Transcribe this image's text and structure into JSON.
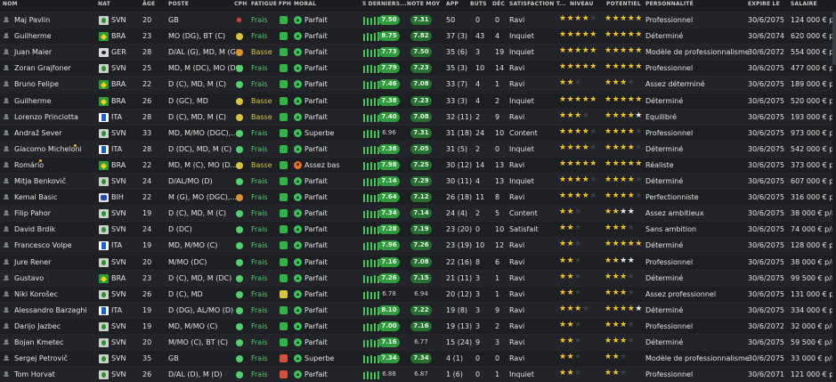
{
  "headers": {
    "nom": "NOM",
    "nat": "NAT",
    "age": "ÂGE",
    "poste": "POSTE",
    "cph": "CPH",
    "fatigue": "FATIGUE",
    "fph": "FPH",
    "moral": "MORAL",
    "derniers": "5 DERNIERS...",
    "note": "NOTE MOY",
    "app": "APP",
    "buts": "BUTS",
    "dec": "DÉC",
    "satisfaction": "SATISFACTION T...",
    "niveau": "NIVEAU",
    "potentiel": "POTENTIEL",
    "personnalite": "PERSONNALITÉ",
    "expire": "EXPIRE LE",
    "salaire": "SALAIRE"
  },
  "rows": [
    {
      "name": "Maj Pavlin",
      "nat": "SVN",
      "age": "20",
      "pos": "GB",
      "cph": "r",
      "fatigue": "Frais",
      "fat_color": "green",
      "fph": "g",
      "moral": "Parfait",
      "moral_c": "g",
      "last5": [
        9,
        8,
        8,
        9,
        9
      ],
      "form_rating": "7.50",
      "note": "7.31",
      "app": "50",
      "buts": "0",
      "dec": "0",
      "satisfaction": "Ravi",
      "niveau": "★★★★",
      "niveau_e": "★",
      "potentiel": "★★★★★",
      "pot_w": "",
      "pot_e": "",
      "personnalite": "Professionnel",
      "expire": "30/6/2075",
      "salaire": "124 000 € p/m"
    },
    {
      "name": "Guilherme",
      "nat": "BRA",
      "age": "23",
      "pos": "MO (DG), BT (C)",
      "cph": "y",
      "fatigue": "Frais",
      "fat_color": "green",
      "fph": "g",
      "moral": "Parfait",
      "moral_c": "g",
      "last5": [
        8,
        9,
        8,
        9,
        10
      ],
      "form_rating": "8.75",
      "note": "7.82",
      "app": "37 (3)",
      "buts": "43",
      "dec": "4",
      "satisfaction": "Inquiet",
      "niveau": "★★★★★",
      "niveau_e": "",
      "potentiel": "★★★★★",
      "pot_w": "",
      "pot_e": "",
      "personnalite": "Déterminé",
      "expire": "30/6/2074",
      "salaire": "620 000 € p/m"
    },
    {
      "name": "Juan Maier",
      "nat": "GER",
      "age": "28",
      "pos": "D/AL (G), MD, M (G)",
      "cph": "o",
      "fatigue": "Basse",
      "fat_color": "yellow",
      "fph": "g",
      "moral": "Parfait",
      "moral_c": "g",
      "last5": [
        8,
        9,
        8,
        9,
        9
      ],
      "form_rating": "7.73",
      "note": "7.50",
      "app": "35 (6)",
      "buts": "3",
      "dec": "19",
      "satisfaction": "Inquiet",
      "niveau": "★★★★★",
      "niveau_e": "",
      "potentiel": "★★★★★",
      "pot_w": "",
      "pot_e": "",
      "personnalite": "Modèle de professionnalisme",
      "expire": "30/6/2072",
      "salaire": "554 000 € p/m"
    },
    {
      "name": "Zoran Grajfoner",
      "nat": "SVN",
      "age": "25",
      "pos": "MD, M (DC), MO (DC)",
      "cph": "h",
      "fatigue": "Frais",
      "fat_color": "green",
      "fph": "g",
      "moral": "Parfait",
      "moral_c": "g",
      "last5": [
        8,
        9,
        9,
        8,
        9
      ],
      "form_rating": "7.79",
      "note": "7.23",
      "app": "35 (3)",
      "buts": "10",
      "dec": "14",
      "satisfaction": "Ravi",
      "niveau": "★★★★★",
      "niveau_e": "",
      "potentiel": "★★★★★",
      "pot_w": "",
      "pot_e": "",
      "personnalite": "Professionnel",
      "expire": "30/6/2075",
      "salaire": "477 000 € p/m"
    },
    {
      "name": "Bruno Felipe",
      "nat": "BRA",
      "age": "22",
      "pos": "D (C), MD, M (C)",
      "cph": "h",
      "fatigue": "Frais",
      "fat_color": "green",
      "fph": "g",
      "moral": "Parfait",
      "moral_c": "g",
      "last5": [
        9,
        8,
        9,
        8,
        9
      ],
      "form_rating": "7.46",
      "note": "7.08",
      "app": "33 (7)",
      "buts": "4",
      "dec": "1",
      "satisfaction": "Ravi",
      "niveau": "★★",
      "niveau_e": "★",
      "potentiel": "★★★",
      "pot_w": "",
      "pot_e": "★",
      "personnalite": "Assez déterminé",
      "expire": "30/6/2075",
      "salaire": "189 000 € p/m"
    },
    {
      "name": "Guilherme",
      "nat": "BRA",
      "age": "26",
      "pos": "D (GC), MD",
      "cph": "y",
      "fatigue": "Basse",
      "fat_color": "yellow",
      "fph": "g",
      "moral": "Parfait",
      "moral_c": "g",
      "last5": [
        8,
        9,
        8,
        9,
        8
      ],
      "form_rating": "7.38",
      "note": "7.23",
      "app": "33 (3)",
      "buts": "4",
      "dec": "2",
      "satisfaction": "Inquiet",
      "niveau": "★★★★★",
      "niveau_e": "",
      "potentiel": "★★★★★",
      "pot_w": "",
      "pot_e": "",
      "personnalite": "Déterminé",
      "expire": "30/6/2075",
      "salaire": "520 000 € p/m"
    },
    {
      "name": "Lorenzo Princiotta",
      "nat": "ITA",
      "age": "28",
      "pos": "D (C), MD, M (C)",
      "cph": "y",
      "fatigue": "Basse",
      "fat_color": "yellow",
      "fph": "g",
      "moral": "Parfait",
      "moral_c": "g",
      "last5": [
        9,
        8,
        8,
        9,
        8
      ],
      "form_rating": "7.40",
      "note": "7.08",
      "app": "32 (11)",
      "buts": "2",
      "dec": "9",
      "satisfaction": "Ravi",
      "niveau": "★★★",
      "niveau_e": "★",
      "potentiel": "★★★★",
      "pot_w": "★",
      "pot_e": "",
      "personnalite": "Equilibré",
      "expire": "30/6/2075",
      "salaire": "193 000 € p/m"
    },
    {
      "name": "Andraž Sever",
      "nat": "SVN",
      "age": "33",
      "pos": "MD, M/MO (DGC),...",
      "cph": "h",
      "fatigue": "Frais",
      "fat_color": "green",
      "fph": "g",
      "moral": "Superbe",
      "moral_c": "g",
      "last5": [
        8,
        9,
        9,
        8,
        9
      ],
      "form_rating": "6.96",
      "note": "7.31",
      "app": "31 (18)",
      "buts": "24",
      "dec": "10",
      "satisfaction": "Content",
      "niveau": "★★★★",
      "niveau_e": "★",
      "potentiel": "★★★★",
      "pot_w": "",
      "pot_e": "★",
      "personnalite": "Professionnel",
      "expire": "30/6/2075",
      "salaire": "973 000 € p/m"
    },
    {
      "name": "Giacomo Micheloni",
      "nat": "ITA",
      "age": "28",
      "pos": "D (DC), MD, M (C)",
      "cph": "h",
      "fatigue": "Frais",
      "fat_color": "green",
      "fph": "g",
      "moral": "Parfait",
      "moral_c": "g",
      "last5": [
        8,
        8,
        9,
        9,
        8
      ],
      "form_rating": "7.38",
      "note": "7.05",
      "app": "31 (5)",
      "buts": "2",
      "dec": "0",
      "satisfaction": "Inquiet",
      "niveau": "★★★★",
      "niveau_e": "★",
      "potentiel": "★★★★",
      "pot_w": "",
      "pot_e": "★",
      "personnalite": "Déterminé",
      "expire": "30/6/2075",
      "salaire": "542 000 € p/m"
    },
    {
      "name": "Romário",
      "nat": "BRA",
      "age": "22",
      "pos": "MD, M (C), MO (D...",
      "cph": "y",
      "fatigue": "Basse",
      "fat_color": "yellow",
      "fph": "g",
      "moral": "Assez bas",
      "moral_c": "o",
      "last5": [
        9,
        8,
        9,
        8,
        9
      ],
      "form_rating": "7.98",
      "note": "7.25",
      "app": "30 (12)",
      "buts": "14",
      "dec": "13",
      "satisfaction": "Ravi",
      "niveau": "★★★★★",
      "niveau_e": "",
      "potentiel": "★★★★★",
      "pot_w": "",
      "pot_e": "",
      "personnalite": "Réaliste",
      "expire": "30/6/2075",
      "salaire": "373 000 € p/m"
    },
    {
      "name": "Mitja Benkovič",
      "nat": "SVN",
      "age": "24",
      "pos": "D/AL/MO (D)",
      "cph": "h",
      "fatigue": "Frais",
      "fat_color": "green",
      "fph": "g",
      "moral": "Parfait",
      "moral_c": "g",
      "last5": [
        8,
        9,
        8,
        9,
        9
      ],
      "form_rating": "7.14",
      "note": "7.29",
      "app": "30 (11)",
      "buts": "4",
      "dec": "13",
      "satisfaction": "Inquiet",
      "niveau": "★★★★",
      "niveau_e": "★",
      "potentiel": "★★★★",
      "pot_w": "",
      "pot_e": "★",
      "personnalite": "Déterminé",
      "expire": "30/6/2075",
      "salaire": "607 000 € p/m"
    },
    {
      "name": "Kemal Basic",
      "nat": "BIH",
      "age": "22",
      "pos": "M (G), MO (DGC),...",
      "cph": "o",
      "fatigue": "Frais",
      "fat_color": "green",
      "fph": "g",
      "moral": "Parfait",
      "moral_c": "g",
      "last5": [
        9,
        9,
        8,
        8,
        9
      ],
      "form_rating": "7.64",
      "note": "7.12",
      "app": "26 (18)",
      "buts": "11",
      "dec": "8",
      "satisfaction": "Ravi",
      "niveau": "★★★★",
      "niveau_e": "★",
      "potentiel": "★★★★",
      "pot_w": "",
      "pot_e": "★",
      "personnalite": "Perfectionniste",
      "expire": "30/6/2075",
      "salaire": "316 000 € p/m"
    },
    {
      "name": "Filip Pahor",
      "nat": "SVN",
      "age": "19",
      "pos": "D (C), MD, M (C)",
      "cph": "h",
      "fatigue": "Frais",
      "fat_color": "green",
      "fph": "g",
      "moral": "Parfait",
      "moral_c": "g",
      "last5": [
        8,
        9,
        8,
        8,
        9
      ],
      "form_rating": "7.34",
      "note": "7.14",
      "app": "24 (4)",
      "buts": "2",
      "dec": "5",
      "satisfaction": "Content",
      "niveau": "★★",
      "niveau_e": "★",
      "potentiel": "★★",
      "pot_w": "★★",
      "pot_e": "",
      "personnalite": "Assez ambitieux",
      "expire": "30/6/2075",
      "salaire": "38 000 € p/m"
    },
    {
      "name": "David Brdik",
      "nat": "SVN",
      "age": "24",
      "pos": "D (DC)",
      "cph": "h",
      "fatigue": "Frais",
      "fat_color": "green",
      "fph": "g",
      "moral": "Parfait",
      "moral_c": "g",
      "last5": [
        9,
        8,
        9,
        8,
        9
      ],
      "form_rating": "7.28",
      "note": "7.19",
      "app": "23 (20)",
      "buts": "0",
      "dec": "10",
      "satisfaction": "Satisfait",
      "niveau": "★★",
      "niveau_e": "★",
      "potentiel": "★★★",
      "pot_w": "",
      "pot_e": "★",
      "personnalite": "Sans ambition",
      "expire": "30/6/2075",
      "salaire": "74 000 € p/m"
    },
    {
      "name": "Francesco Volpe",
      "nat": "ITA",
      "age": "19",
      "pos": "MD, M/MO (C)",
      "cph": "h",
      "fatigue": "Frais",
      "fat_color": "green",
      "fph": "g",
      "moral": "Parfait",
      "moral_c": "g",
      "last5": [
        8,
        9,
        9,
        8,
        9
      ],
      "form_rating": "7.96",
      "note": "7.26",
      "app": "23 (19)",
      "buts": "10",
      "dec": "12",
      "satisfaction": "Ravi",
      "niveau": "★★",
      "niveau_e": "★",
      "potentiel": "★★★★★",
      "pot_w": "",
      "pot_e": "",
      "personnalite": "Déterminé",
      "expire": "30/6/2075",
      "salaire": "128 000 € p/m"
    },
    {
      "name": "Jure Rener",
      "nat": "SVN",
      "age": "20",
      "pos": "M/MO (DC)",
      "cph": "h",
      "fatigue": "Frais",
      "fat_color": "green",
      "fph": "g",
      "moral": "Parfait",
      "moral_c": "g",
      "last5": [
        8,
        8,
        9,
        8,
        9
      ],
      "form_rating": "7.16",
      "note": "7.08",
      "app": "22 (16)",
      "buts": "8",
      "dec": "6",
      "satisfaction": "Ravi",
      "niveau": "★★",
      "niveau_e": "★",
      "potentiel": "★★",
      "pot_w": "★★",
      "pot_e": "",
      "personnalite": "Professionnel",
      "expire": "30/6/2075",
      "salaire": "38 000 € p/m"
    },
    {
      "name": "Gustavo",
      "nat": "BRA",
      "age": "23",
      "pos": "D (C), MD, M (DC)",
      "cph": "h",
      "fatigue": "Frais",
      "fat_color": "green",
      "fph": "g",
      "moral": "Parfait",
      "moral_c": "g",
      "last5": [
        9,
        8,
        8,
        9,
        8
      ],
      "form_rating": "7.26",
      "note": "7.15",
      "app": "21 (11)",
      "buts": "3",
      "dec": "1",
      "satisfaction": "Ravi",
      "niveau": "★★",
      "niveau_e": "★",
      "potentiel": "★★★",
      "pot_w": "",
      "pot_e": "★",
      "personnalite": "Déterminé",
      "expire": "30/6/2075",
      "salaire": "99 500 € p/m"
    },
    {
      "name": "Niki Korošec",
      "nat": "SVN",
      "age": "26",
      "pos": "D (C), MD",
      "cph": "h",
      "fatigue": "Frais",
      "fat_color": "green",
      "fph": "y",
      "moral": "Parfait",
      "moral_c": "g",
      "last5": [
        8,
        9,
        8,
        8,
        9
      ],
      "form_rating": "6.78",
      "note": "6.94",
      "app": "20 (12)",
      "buts": "3",
      "dec": "1",
      "satisfaction": "Ravi",
      "niveau": "★★",
      "niveau_e": "★",
      "potentiel": "★★★",
      "pot_w": "",
      "pot_e": "★",
      "personnalite": "Assez professionnel",
      "expire": "30/6/2075",
      "salaire": "131 000 € p/m"
    },
    {
      "name": "Alessandro Barzaghi",
      "nat": "ITA",
      "age": "19",
      "pos": "D (DG), AL/MO (D)",
      "cph": "h",
      "fatigue": "Frais",
      "fat_color": "green",
      "fph": "g",
      "moral": "Parfait",
      "moral_c": "g",
      "last5": [
        9,
        9,
        8,
        9,
        9
      ],
      "form_rating": "8.10",
      "note": "7.22",
      "app": "19 (8)",
      "buts": "3",
      "dec": "9",
      "satisfaction": "Ravi",
      "niveau": "★★★",
      "niveau_e": "★",
      "potentiel": "★★★★",
      "pot_w": "★",
      "pot_e": "",
      "personnalite": "Déterminé",
      "expire": "30/6/2075",
      "salaire": "334 000 € p/m"
    },
    {
      "name": "Darijo Jazbec",
      "nat": "SVN",
      "age": "19",
      "pos": "MD, M/MO (C)",
      "cph": "h",
      "fatigue": "Frais",
      "fat_color": "green",
      "fph": "g",
      "moral": "Parfait",
      "moral_c": "g",
      "last5": [
        8,
        9,
        8,
        9,
        8
      ],
      "form_rating": "7.00",
      "note": "7.16",
      "app": "19 (13)",
      "buts": "3",
      "dec": "2",
      "satisfaction": "Ravi",
      "niveau": "★★",
      "niveau_e": "★",
      "potentiel": "★★★",
      "pot_w": "",
      "pot_e": "★",
      "personnalite": "Professionnel",
      "expire": "30/6/2072",
      "salaire": "32 000 € p/m"
    },
    {
      "name": "Bojan Kmetec",
      "nat": "SVN",
      "age": "20",
      "pos": "M/MO (C), BT (C)",
      "cph": "h",
      "fatigue": "Frais",
      "fat_color": "green",
      "fph": "g",
      "moral": "Parfait",
      "moral_c": "g",
      "last5": [
        8,
        8,
        9,
        8,
        9
      ],
      "form_rating": "7.16",
      "note": "6.77",
      "app": "15 (24)",
      "buts": "9",
      "dec": "3",
      "satisfaction": "Ravi",
      "niveau": "★★",
      "niveau_e": "★",
      "potentiel": "★★★",
      "pot_w": "",
      "pot_e": "★",
      "personnalite": "Déterminé",
      "expire": "30/6/2075",
      "salaire": "59 500 € p/m"
    },
    {
      "name": "Sergej Petrovič",
      "nat": "SVN",
      "age": "35",
      "pos": "GB",
      "cph": "h",
      "fatigue": "Frais",
      "fat_color": "green",
      "fph": "r",
      "moral": "Superbe",
      "moral_c": "g",
      "last5": [
        9,
        8,
        9,
        8,
        9
      ],
      "form_rating": "7.34",
      "note": "7.34",
      "app": "4 (1)",
      "buts": "0",
      "dec": "0",
      "satisfaction": "Ravi",
      "niveau": "★★",
      "niveau_e": "★",
      "potentiel": "★★",
      "pot_w": "",
      "pot_e": "★",
      "personnalite": "Modèle de professionnalisme",
      "expire": "30/6/2075",
      "salaire": "33 000 € p/m"
    },
    {
      "name": "Tom Horvat",
      "nat": "SVN",
      "age": "26",
      "pos": "D/AL (D), M (D)",
      "cph": "h",
      "fatigue": "Frais",
      "fat_color": "green",
      "fph": "r",
      "moral": "Parfait",
      "moral_c": "g",
      "last5": [
        8,
        9,
        8,
        8,
        9
      ],
      "form_rating": "6.88",
      "note": "6.87",
      "app": "1 (6)",
      "buts": "0",
      "dec": "1",
      "satisfaction": "Inquiet",
      "niveau": "★★",
      "niveau_e": "★",
      "potentiel": "★★",
      "pot_w": "",
      "pot_e": "★",
      "personnalite": "Professionnel",
      "expire": "30/6/2071",
      "salaire": "121 000 € p/m"
    }
  ]
}
